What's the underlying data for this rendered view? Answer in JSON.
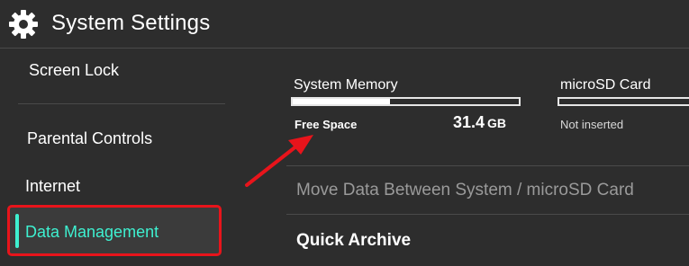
{
  "header": {
    "title": "System Settings",
    "icon": "gear-icon"
  },
  "sidebar": {
    "items": [
      {
        "label": "Screen Lock"
      },
      {
        "label": "Parental Controls"
      },
      {
        "label": "Internet"
      },
      {
        "label": "Data Management",
        "selected": true
      }
    ]
  },
  "storage": {
    "system": {
      "title": "System Memory",
      "free_label": "Free Space",
      "free_value": "31.4",
      "free_unit": "GB",
      "used_fraction": 0.43
    },
    "sd": {
      "title": "microSD Card",
      "status": "Not inserted"
    }
  },
  "main": {
    "rows": [
      {
        "label": "Move Data Between System / microSD Card",
        "dimmed": true
      },
      {
        "label": "Quick Archive",
        "dimmed": false
      }
    ]
  },
  "colors": {
    "background": "#2d2d2d",
    "accent": "#3ef0d0",
    "highlight_border": "#e8141b",
    "arrow": "#e8141b"
  }
}
